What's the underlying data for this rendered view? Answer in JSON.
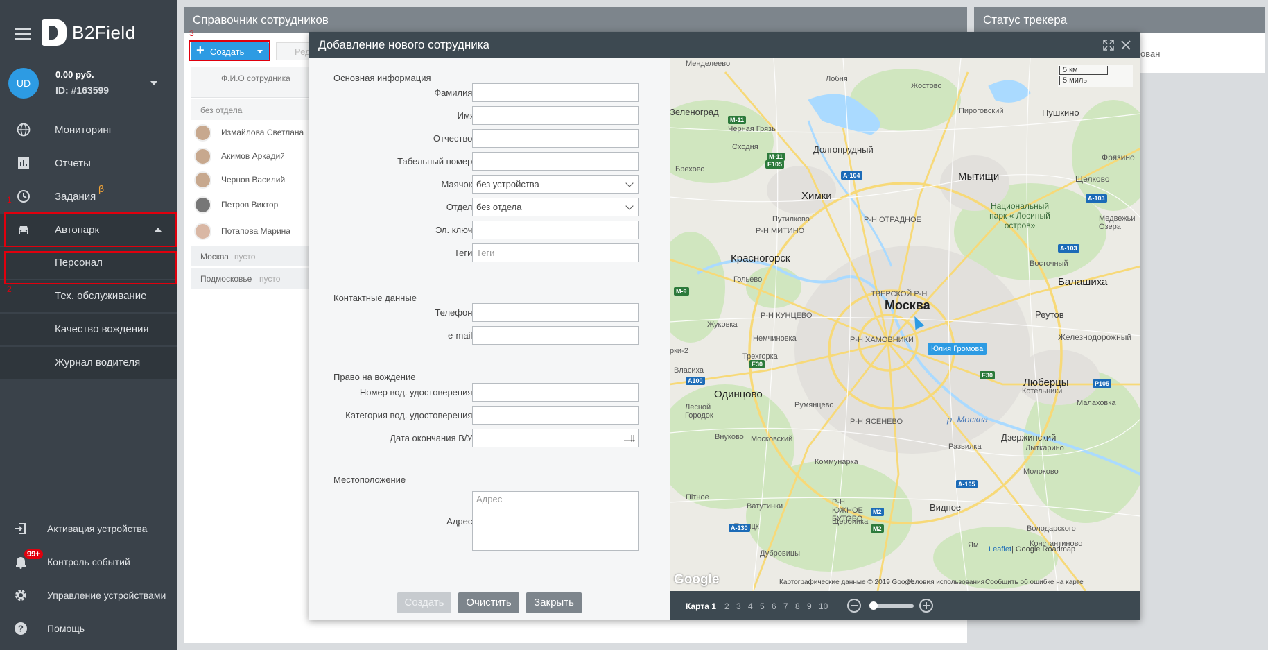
{
  "app": {
    "logo_text": "B2Field"
  },
  "user": {
    "initials": "UD",
    "balance": "0.00 руб.",
    "id": "ID: #163599"
  },
  "sidebar": {
    "items": [
      {
        "label": "Мониторинг"
      },
      {
        "label": "Отчеты"
      },
      {
        "label": "Задания"
      },
      {
        "label": "Автопарк"
      }
    ],
    "beta": "β",
    "sub_items": [
      {
        "label": "Персонал"
      },
      {
        "label": "Тех. обслуживание"
      },
      {
        "label": "Качество вождения"
      },
      {
        "label": "Журнал водителя"
      }
    ],
    "bottom": [
      {
        "label": "Активация устройства"
      },
      {
        "label": "Контроль событий"
      },
      {
        "label": "Управление устройствами"
      },
      {
        "label": "Помощь"
      }
    ],
    "events_badge": "99+"
  },
  "annotations": {
    "n1": "1",
    "n2": "2",
    "n3": "3"
  },
  "directory": {
    "title": "Справочник сотрудников",
    "create_label": "Создать",
    "edit_label": "Ред",
    "column_name": "Ф.И.О сотрудника",
    "group_none": "без отдела",
    "employees": [
      "Измайлова Светлана",
      "Акимов Аркадий",
      "Чернов Василий",
      "Петров Виктор",
      "Потапова Марина"
    ],
    "groups": [
      {
        "name": "Москва",
        "status": "пусто"
      },
      {
        "name": "Подмосковье",
        "status": "пусто"
      }
    ]
  },
  "tracker_panel": {
    "title": "Статус трекера",
    "partial_text": "ован"
  },
  "modal": {
    "title": "Добавление нового сотрудника",
    "sections": {
      "main": "Основная информация",
      "contacts": "Контактные данные",
      "driving": "Право на вождение",
      "location": "Местоположение"
    },
    "fields": {
      "surname": "Фамилия:",
      "name": "Имя",
      "patronymic": "Отчество:",
      "tab_number": "Табельный номер:",
      "beacon": "Маячок:",
      "department": "Отдел:",
      "e_key": "Эл. ключ:",
      "tags": "Теги:",
      "phone": "Телефон:",
      "email": "e-mail:",
      "license_number": "Номер вод. удостоверения:",
      "license_category": "Категория вод. удостоверения:",
      "license_expiry": "Дата окончания В/У:",
      "address": "Адрес:"
    },
    "values": {
      "beacon": "без устройства",
      "department": "без отдела"
    },
    "placeholders": {
      "tags": "Теги",
      "address": "Адрес"
    },
    "buttons": {
      "create": "Создать",
      "clear": "Очистить",
      "close": "Закрыть"
    }
  },
  "map": {
    "tracker_name": "Юлия Громова",
    "scale_km": "5 км",
    "scale_mi": "5 миль",
    "google": "Google",
    "leaflet": "Leaflet",
    "roadmap": "| Google Roadmap",
    "attribution": "Картографические данные © 2019 Google",
    "terms": "Условия использования",
    "report": "Сообщить об ошибке на карте",
    "labels": {
      "moscow": "Москва",
      "tverskoy": "ТВЕРСКОЙ Р-Н",
      "khamovniki": "Р-Н ХАМОВНИКИ",
      "khimki": "Химки",
      "mytishchi": "Мытищи",
      "balashikha": "Балашиха",
      "lyubertsy": "Люберцы",
      "odintsovo": "Одинцово",
      "vidnoe": "Видное",
      "krasnogorsk": "Красногорск",
      "dolgoprudny": "Долгопрудный",
      "reutov": "Реутов",
      "dzerzhinsky": "Дзержинский",
      "zelenograd": "Зеленоград",
      "pushkino": "Пушкино",
      "shchelkovo": "Щелково",
      "zheleznodorozhny": "Железнодорожный",
      "national_park": "Национальный парк « Лосиный остров»",
      "moskva_river": "р. Москва",
      "mendeleevo": "Менделеево",
      "lobnya": "Лобня",
      "zhostovo": "Жостово",
      "pirogovsky": "Пироговский",
      "chernaya_gryaz": "Черная Грязь",
      "skhodnya": "Сходня",
      "brekhovo": "Брехово",
      "putilkovo": "Путилково",
      "mitino": "Р-Н МИТИНО",
      "otradnoe": "Р-Н ОТРАДНОЕ",
      "golyevo": "Гольево",
      "zhukovka": "Жуковка",
      "kuntsevo": "Р-Н КУНЦЕВО",
      "nemchinovka": "Немчиновка",
      "trekhgorka": "Трехгорка",
      "vlasikha": "Власиха",
      "lesnoy_gorodok": "Лесной Городок",
      "rumyantsevo": "Румянцево",
      "yasenevo": "Р-Н ЯСЕНЕВО",
      "vnukovo": "Внуково",
      "moskovsky": "Московский",
      "kommunarka": "Коммунарка",
      "razvilka": "Развилка",
      "kotelniki": "Котельники",
      "malakhovka": "Малаховка",
      "lytkarino": "Лыткарино",
      "molokovo": "Молоково",
      "pitnoe": "Пітное",
      "vatutinki": "Ватутинки",
      "butovo": "Р-Н ЮЖНОЕ БУТОВО",
      "shcherbinka": "Щербинка",
      "troitsk": "Троицк",
      "dubrovitsy": "Дубровицы",
      "volodarskoe": "Володарского",
      "konstantinovo": "Константиново",
      "yam": "Ям",
      "vostochny": "Восточный",
      "fryazino": "Фрязино",
      "medvezhi": "Медвежьи Озера",
      "krasnogorsk2": "рки-2"
    },
    "pages": [
      "Карта 1",
      "2",
      "3",
      "4",
      "5",
      "6",
      "7",
      "8",
      "9",
      "10"
    ]
  }
}
